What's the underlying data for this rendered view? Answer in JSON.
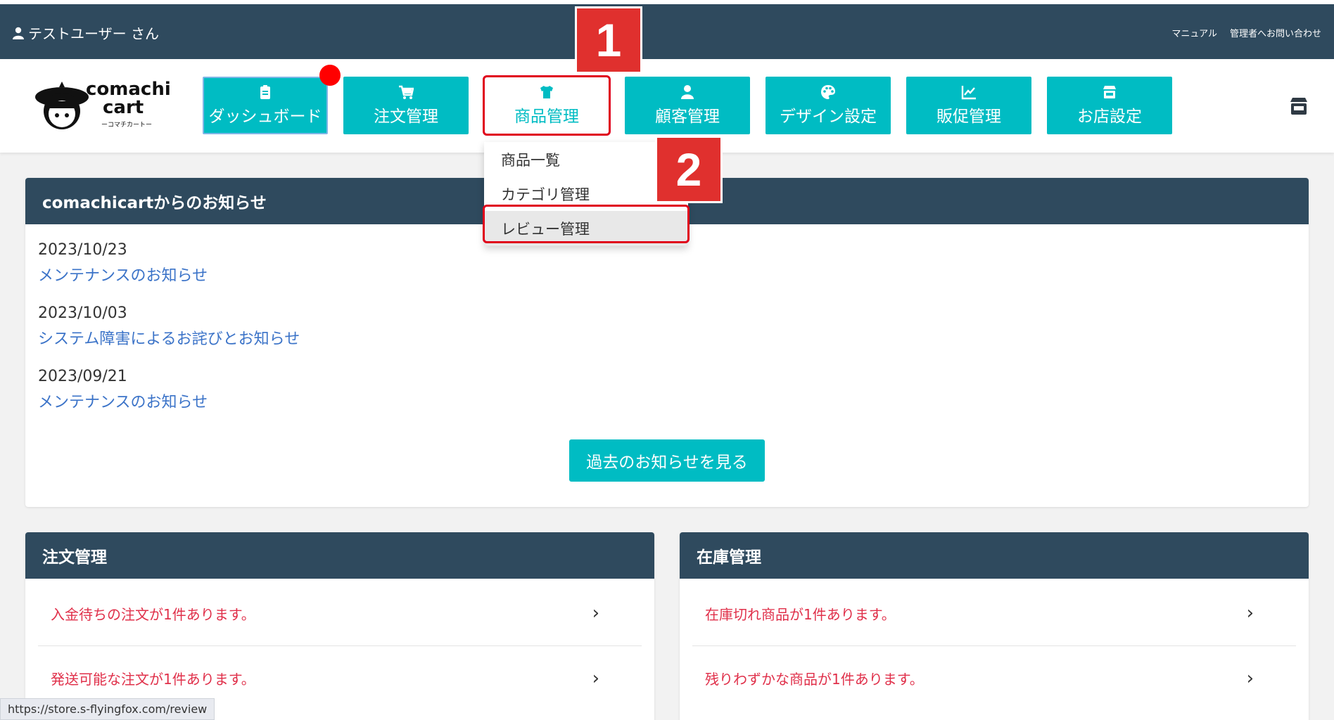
{
  "topbar": {
    "user": "テストユーザー さん",
    "links": [
      "マニュアル",
      "管理者へお問い合わせ"
    ]
  },
  "logo": {
    "line1": "comachi",
    "line2": "cart",
    "sub": "ーコマチカートー"
  },
  "nav": {
    "items": [
      {
        "label": "ダッシュボード",
        "icon": "clipboard-icon"
      },
      {
        "label": "注文管理",
        "icon": "cart-icon"
      },
      {
        "label": "商品管理",
        "icon": "tshirt-icon"
      },
      {
        "label": "顧客管理",
        "icon": "person-icon"
      },
      {
        "label": "デザイン設定",
        "icon": "palette-icon"
      },
      {
        "label": "販促管理",
        "icon": "chart-line-icon"
      },
      {
        "label": "お店設定",
        "icon": "store-icon"
      }
    ]
  },
  "dropdown": {
    "items": [
      "商品一覧",
      "カテゴリ管理",
      "レビュー管理"
    ]
  },
  "badges": {
    "one": "1",
    "two": "2"
  },
  "notices": {
    "title": "comachicartからのお知らせ",
    "items": [
      {
        "date": "2023/10/23",
        "title": "メンテナンスのお知らせ"
      },
      {
        "date": "2023/10/03",
        "title": "システム障害によるお詫びとお知らせ"
      },
      {
        "date": "2023/09/21",
        "title": "メンテナンスのお知らせ"
      }
    ],
    "more_button": "過去のお知らせを見る"
  },
  "orders": {
    "title": "注文管理",
    "rows": [
      "入金待ちの注文が1件あります。",
      "発送可能な注文が1件あります。"
    ]
  },
  "stock": {
    "title": "在庫管理",
    "rows": [
      "在庫切れ商品が1件あります。",
      "残りわずかな商品が1件あります。"
    ]
  },
  "status_url": "https://store.s-flyingfox.com/review",
  "colors": {
    "header": "#2f4a5e",
    "accent": "#00bcc3",
    "alert": "#e0304a",
    "highlight": "#e0001b"
  }
}
